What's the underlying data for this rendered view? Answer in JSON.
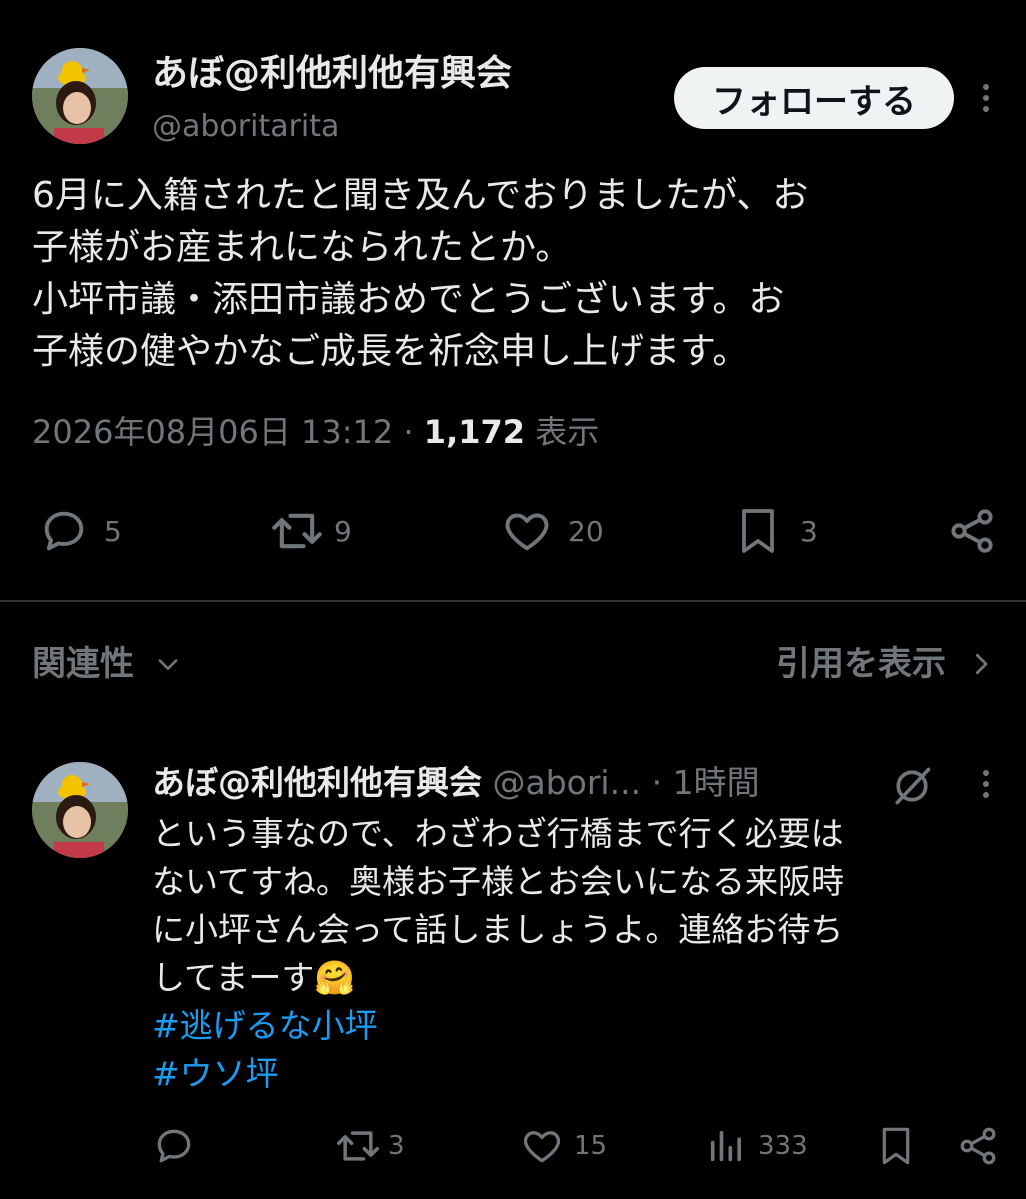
{
  "tweet": {
    "author_name": "あぼ@利他利他有興会",
    "handle": "@aboritarita",
    "follow_label": "フォローする",
    "text": "6月に入籍されたと聞き及んでおりましたが、お\n子様がお産まれになられたとか。\n小坪市議・添田市議おめでとうございます。お\n子様の健やかなご成長を祈念申し上げます。",
    "timestamp": "2026年08月06日 13:12",
    "separator": "·",
    "views_count": "1,172",
    "views_label": "表示",
    "actions": {
      "replies": "5",
      "retweets": "9",
      "likes": "20",
      "bookmarks": "3"
    }
  },
  "sections": {
    "relevance_label": "関連性",
    "quotes_label": "引用を表示"
  },
  "reply": {
    "author_name": "あぼ@利他利他有興会",
    "handle": "@abori...",
    "separator": "·",
    "time": "1時間",
    "text": "という事なので、わざわざ行橋まで行く必要は\nないてすね。奥様お子様とお会いになる来阪時\nに小坪さん会って話しましょうよ。連絡お待ち\nしてまーす🤗",
    "hashtags": [
      "#逃げるな小坪",
      "#ウソ坪"
    ],
    "actions": {
      "replies": "",
      "retweets": "3",
      "likes": "15",
      "views": "333"
    }
  },
  "colors": {
    "background": "#000000",
    "text": "#e7e9ea",
    "muted": "#71767b",
    "link": "#1d9bf0",
    "follow_button_bg": "#eff3f4"
  }
}
